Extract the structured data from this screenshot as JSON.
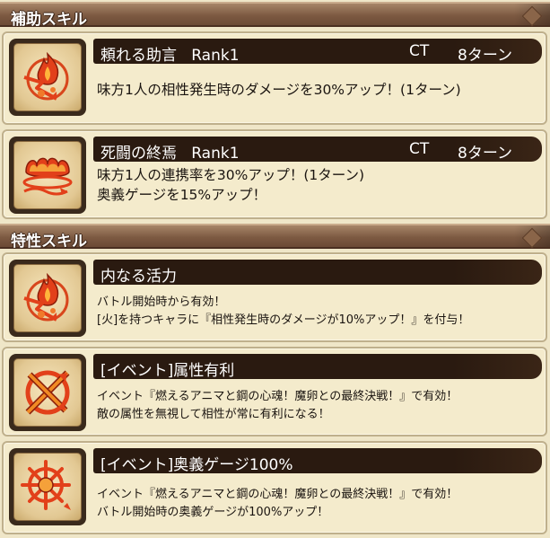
{
  "support_section": {
    "title": "補助スキル"
  },
  "support_skills": [
    {
      "name": "頼れる助言",
      "rank": "Rank1",
      "ct_label": "CT",
      "ct_value": "8ターン",
      "lines": [
        "味方1人の相性発生時のダメージを30%アップ！(1ターン)"
      ],
      "icon": "flame-bolt-icon"
    },
    {
      "name": "死闘の終焉",
      "rank": "Rank1",
      "ct_label": "CT",
      "ct_value": "8ターン",
      "lines": [
        "味方1人の連携率を30%アップ！(1ターン)",
        "奥義ゲージを15%アップ！"
      ],
      "icon": "flame-waves-icon"
    }
  ],
  "trait_section": {
    "title": "特性スキル"
  },
  "trait_skills": [
    {
      "name": "内なる活力",
      "lines": [
        "バトル開始時から有効！",
        "[火]を持つキャラに『相性発生時のダメージが10%アップ！』を付与！"
      ],
      "icon": "flame-bolt-icon"
    },
    {
      "name": "[イベント]属性有利",
      "lines": [
        "イベント『燃えるアニマと鋼の心魂！魔卵との最終決戦！』で有効！",
        "敵の属性を無視して相性が常に有利になる！"
      ],
      "icon": "crossed-arrows-icon"
    },
    {
      "name": "[イベント]奥義ゲージ100%",
      "lines": [
        "イベント『燃えるアニマと鋼の心魂！魔卵との最終決戦！』で有効！",
        "バトル開始時の奥義ゲージが100%アップ！"
      ],
      "icon": "sun-arrow-icon"
    }
  ],
  "colors": {
    "section_header": "#7d5a42",
    "name_bar": "#2a1a10",
    "card_bg": "#f4ebcc",
    "icon_fire": "#e0401a"
  }
}
